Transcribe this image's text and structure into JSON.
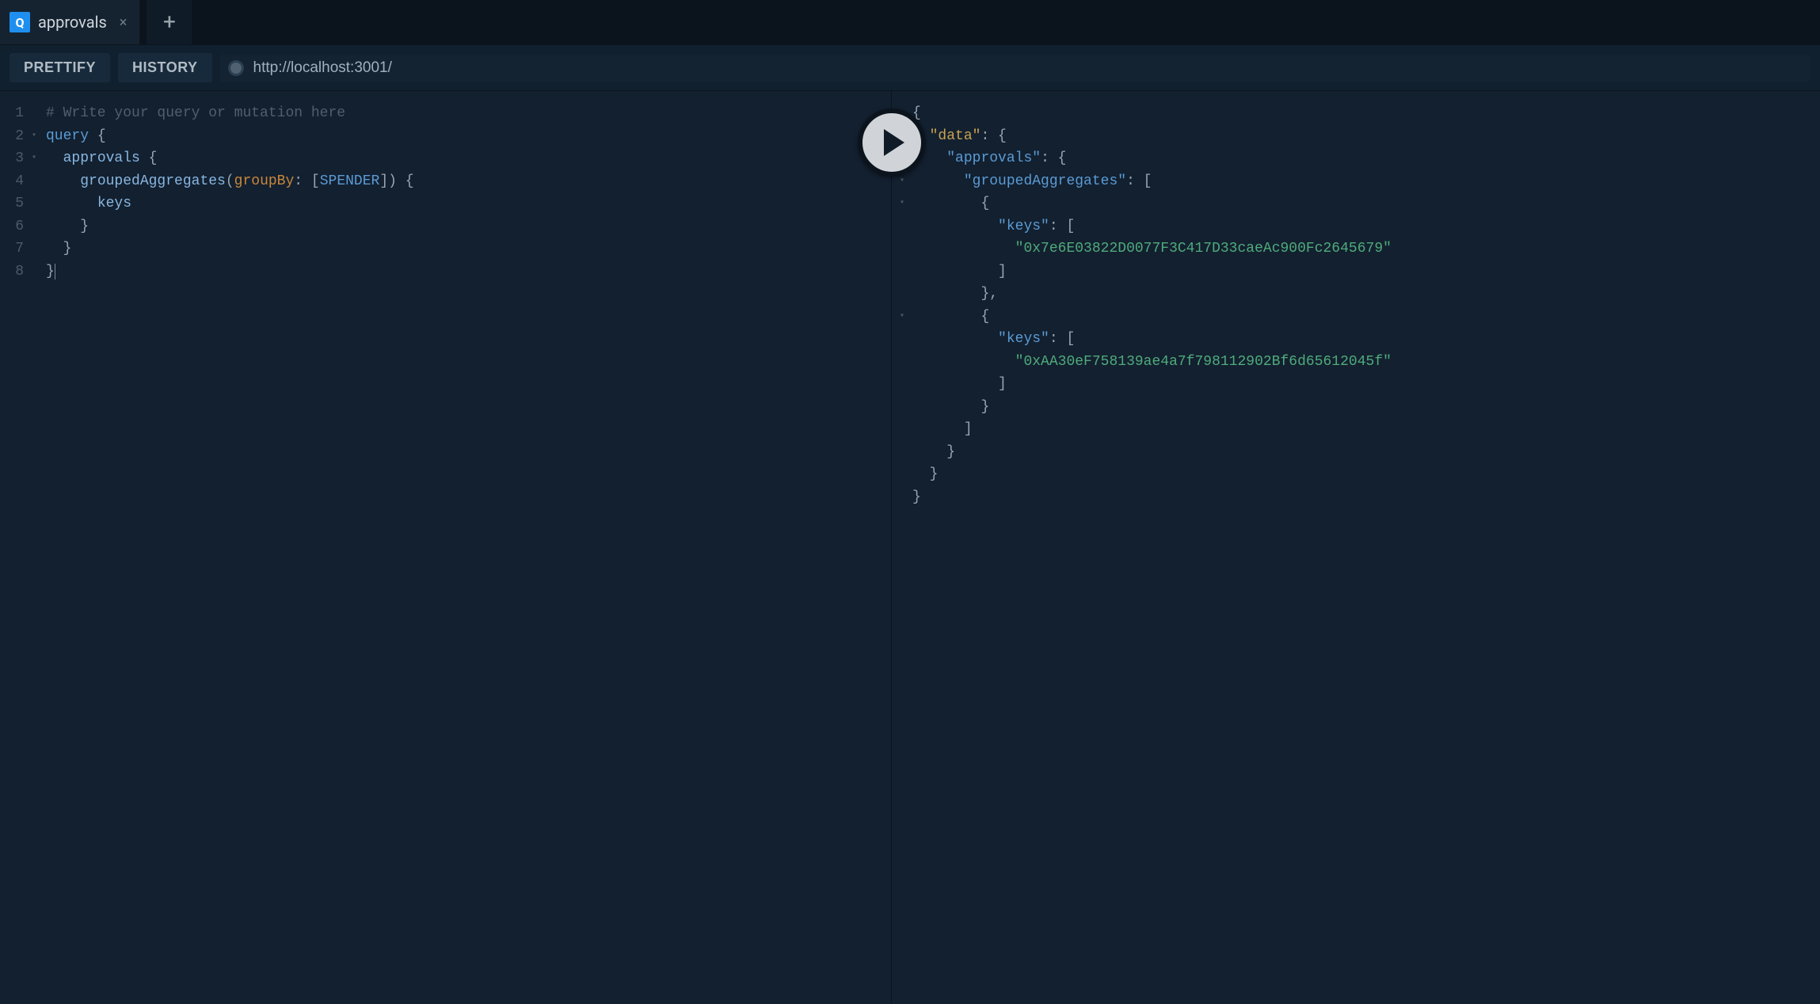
{
  "tabs": {
    "active": {
      "badge": "Q",
      "title": "approvals"
    }
  },
  "toolbar": {
    "prettify": "PRETTIFY",
    "history": "HISTORY",
    "endpoint": "http://localhost:3001/"
  },
  "query_editor": {
    "lines": [
      "1",
      "2",
      "3",
      "4",
      "5",
      "6",
      "7",
      "8"
    ],
    "folds": [
      "",
      "▾",
      "▾",
      "",
      "",
      "",
      "",
      ""
    ],
    "code": {
      "l1_comment": "# Write your query or mutation here",
      "l2_kw": "query",
      "l2_brace": " {",
      "l3_field": "approvals",
      "l3_brace": " {",
      "l4_field": "groupedAggregates",
      "l4_paren_open": "(",
      "l4_arg": "groupBy",
      "l4_colon": ": ",
      "l4_bracket_open": "[",
      "l4_enum": "SPENDER",
      "l4_bracket_close": "]",
      "l4_paren_close": ")",
      "l4_brace": " {",
      "l5_field": "keys",
      "l6_brace": "}",
      "l7_brace": "}",
      "l8_brace": "}"
    }
  },
  "result": {
    "folds": [
      "▾",
      "▾",
      "▾",
      "▾",
      "▾",
      "",
      "",
      "",
      "",
      "▾",
      "",
      "",
      "",
      "",
      "",
      "",
      "",
      ""
    ],
    "json": {
      "data_key": "\"data\"",
      "approvals_key": "\"approvals\"",
      "grouped_key": "\"groupedAggregates\"",
      "keys_key": "\"keys\"",
      "val0": "\"0x7e6E03822D0077F3C417D33caeAc900Fc2645679\"",
      "val1": "\"0xAA30eF758139ae4a7f798112902Bf6d65612045f\""
    }
  }
}
